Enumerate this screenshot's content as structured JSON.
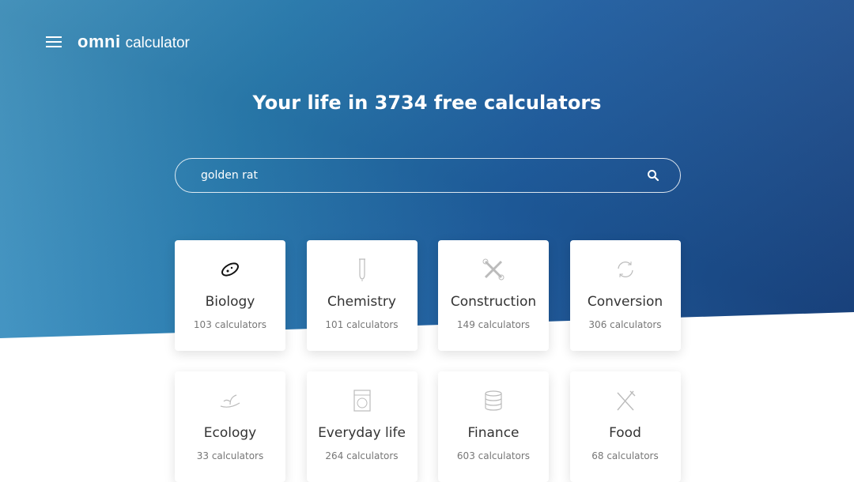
{
  "header": {
    "logo_brand": "omni",
    "logo_suffix": "calculator"
  },
  "hero": {
    "title": "Your life in 3734 free calculators"
  },
  "search": {
    "value": "golden rat",
    "icon": "search-icon"
  },
  "categories": [
    {
      "name": "Biology",
      "count": "103 calculators",
      "icon": "bacteria-icon"
    },
    {
      "name": "Chemistry",
      "count": "101 calculators",
      "icon": "test-tube-icon"
    },
    {
      "name": "Construction",
      "count": "149 calculators",
      "icon": "wrenches-icon"
    },
    {
      "name": "Conversion",
      "count": "306 calculators",
      "icon": "refresh-icon"
    },
    {
      "name": "Ecology",
      "count": "33 calculators",
      "icon": "plant-hand-icon"
    },
    {
      "name": "Everyday life",
      "count": "264 calculators",
      "icon": "washing-machine-icon"
    },
    {
      "name": "Finance",
      "count": "603 calculators",
      "icon": "coins-icon"
    },
    {
      "name": "Food",
      "count": "68 calculators",
      "icon": "fork-knife-icon"
    }
  ]
}
